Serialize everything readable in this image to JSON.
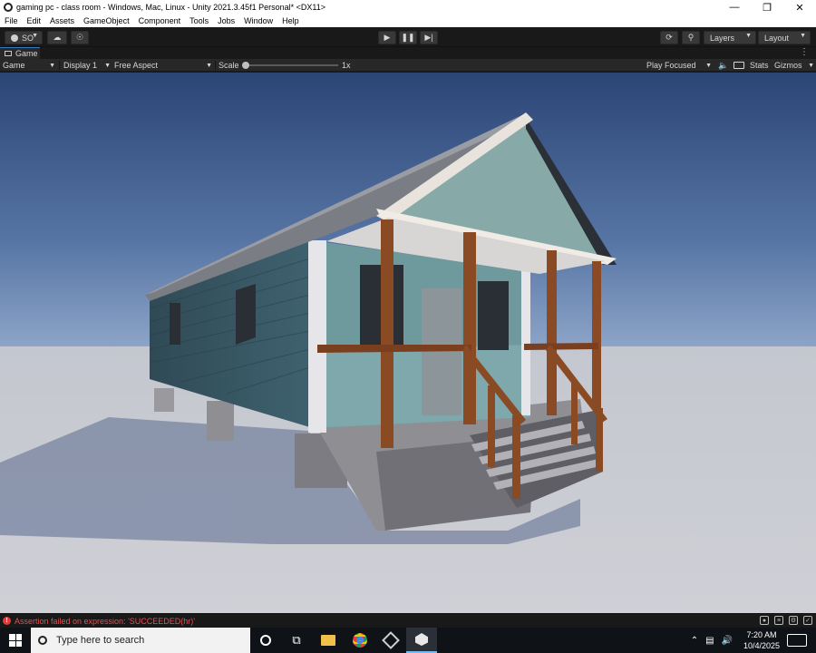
{
  "window": {
    "title": "gaming pc - class room - Windows, Mac, Linux - Unity 2021.3.45f1 Personal* <DX11>",
    "controls": [
      "minimize-icon",
      "restore-icon",
      "close-icon"
    ]
  },
  "menu": {
    "items": [
      "File",
      "Edit",
      "Assets",
      "GameObject",
      "Component",
      "Tools",
      "Jobs",
      "Window",
      "Help"
    ]
  },
  "toolbar": {
    "account_label": "SO",
    "layers_label": "Layers",
    "layout_label": "Layout"
  },
  "tab": {
    "label": "Game"
  },
  "gamebar": {
    "mode": "Game",
    "display": "Display 1",
    "aspect": "Free Aspect",
    "scale_label": "Scale",
    "scale_value": "1x",
    "play_mode": "Play Focused",
    "stats": "Stats",
    "gizmos": "Gizmos"
  },
  "console": {
    "error_message": "Assertion failed on expression: 'SUCCEEDED(hr)'"
  },
  "taskbar": {
    "search_placeholder": "Type here to search",
    "time": "7:20 AM",
    "date": "10/4/2025"
  },
  "colors": {
    "accent": "#3a78c8",
    "error": "#e85050",
    "sky": "#2f4a7a",
    "wall": "#6e9a9e",
    "post": "#8a4a24"
  }
}
